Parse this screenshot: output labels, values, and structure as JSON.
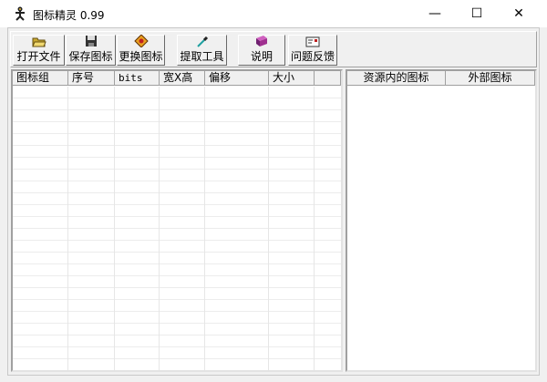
{
  "window": {
    "title": "图标精灵 0.99",
    "minimize": "—",
    "maximize": "☐",
    "close": "✕"
  },
  "toolbar": [
    {
      "label": "打开文件",
      "icon": "folder-open-icon"
    },
    {
      "label": "保存图标",
      "icon": "floppy-disk-icon"
    },
    {
      "label": "更换图标",
      "icon": "replace-icon"
    },
    {
      "label": "提取工具",
      "icon": "eyedropper-icon"
    },
    {
      "label": "说明",
      "icon": "book-icon"
    },
    {
      "label": "问题反馈",
      "icon": "feedback-card-icon"
    }
  ],
  "left_table": {
    "columns": [
      "图标组",
      "序号",
      "bits",
      "宽X高",
      "偏移",
      "大小",
      ""
    ]
  },
  "right_table": {
    "columns": [
      "资源内的图标",
      "外部图标"
    ]
  }
}
